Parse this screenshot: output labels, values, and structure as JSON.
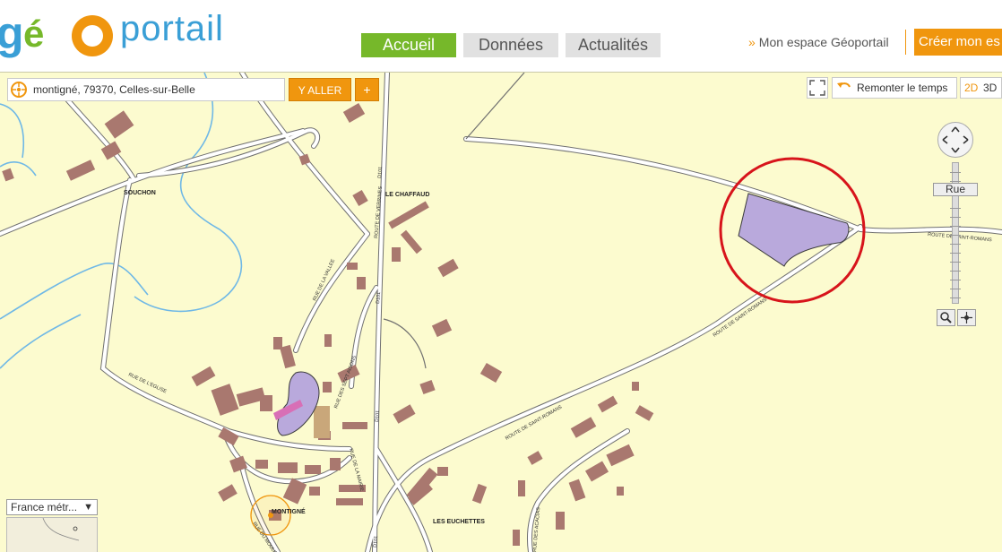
{
  "header": {
    "logo": {
      "text": "portail"
    },
    "nav": [
      {
        "label": "Accueil",
        "active": true
      },
      {
        "label": "Données"
      },
      {
        "label": "Actualités"
      }
    ],
    "espace_label": "Mon espace Géoportail",
    "creer_label": "Créer mon es"
  },
  "search": {
    "value": "montigné, 79370, Celles-sur-Belle",
    "go_label": "Y ALLER",
    "plus_label": "+"
  },
  "controls": {
    "time_label": "Remonter le temps",
    "mode_2d": "2D",
    "mode_3d": "3D",
    "zoom_level_label": "Rue",
    "projection": "France métr..."
  },
  "map_labels": {
    "souchon": "SOUCHON",
    "chaffaud": "LE CHAFFAUD",
    "montigne": "MONTIGNÉ",
    "euchettes": "LES EUCHETTES",
    "route_st_romans_1": "ROUTE DE SAINT-ROMANS",
    "route_st_romans_2": "ROUTE DE SAINT-ROMANS",
    "route_st_romans_3": "ROUTE DE SAINT-ROMANS",
    "rue_eglise": "RUE DE L'EGLISE",
    "rue_vallee": "RUE DE LA VALLEE",
    "rue_sept_aisons": "RUE DES SEPT AISONS",
    "rue_mairie": "RUE DE LA MAIRIE",
    "route_verrines": "ROUTE DE VERRINES",
    "rue_acacias": "RUE DES ACACIAS",
    "rue_moulin": "RUE DU MOULIN",
    "d101_a": "D101",
    "d101_b": "D101",
    "d101_c": "D101",
    "d101_d": "D101"
  },
  "colors": {
    "map_bg": "#fcfbcf",
    "building": "#a9786f",
    "water": "#6fb8e6",
    "road_fill": "#ffffff",
    "road_edge": "#707070",
    "parcel": "#b9a9dc",
    "highlight_circle": "#d7141b",
    "accent_orange": "#f0960e",
    "nav_green": "#76b82a"
  }
}
